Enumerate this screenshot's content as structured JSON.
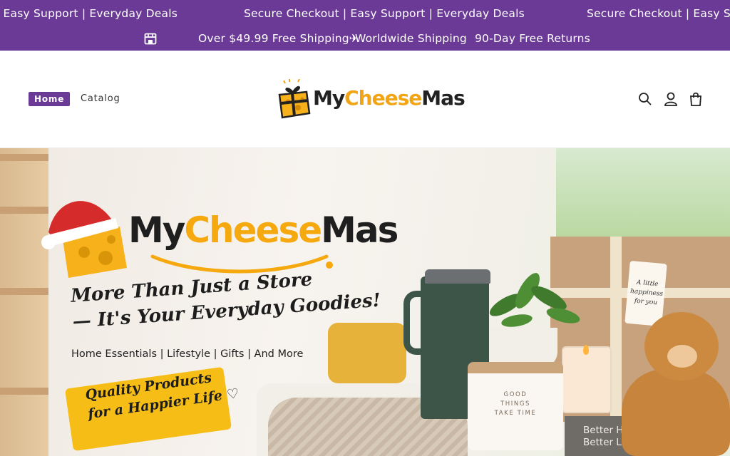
{
  "announcement": {
    "marquee_text_1": "| Easy Support | Everyday Deals",
    "marquee_text_2": "Secure Checkout | Easy Support | Everyday Deals",
    "marquee_text_3": "Secure Checkout | Easy Su",
    "shipping_free": "Over $49.99 Free Shipping✈",
    "shipping_world": "Worldwide Shipping",
    "returns": "90-Day Free Returns"
  },
  "header": {
    "nav": {
      "home": "Home",
      "catalog": "Catalog"
    },
    "logo": {
      "part1": "My",
      "part2": "Cheese",
      "part3": "Mas"
    }
  },
  "hero": {
    "brand_part1": "My",
    "brand_part2": "Cheese",
    "brand_part3": "Mas",
    "tagline_line1": "More Than Just a Store",
    "tagline_line2": "— It's Your Everyday Goodies!",
    "categories": "Home Essentials  |  Lifestyle  |  Gifts  |  And More",
    "badge_line1": "Quality Products",
    "badge_line2": "for a Happier Life ♡",
    "jar_text_1": "GOOD",
    "jar_text_2": "THINGS",
    "jar_text_3": "TAKE TIME",
    "tag_text_1": "A little",
    "tag_text_2": "happiness",
    "tag_text_3": "for you",
    "book_line1": "Better Home",
    "book_line2": "Better Life"
  },
  "colors": {
    "brand_purple": "#6b3a96",
    "brand_yellow": "#f5a90f"
  },
  "icons": [
    "store-icon",
    "search-icon",
    "account-icon",
    "cart-icon"
  ]
}
